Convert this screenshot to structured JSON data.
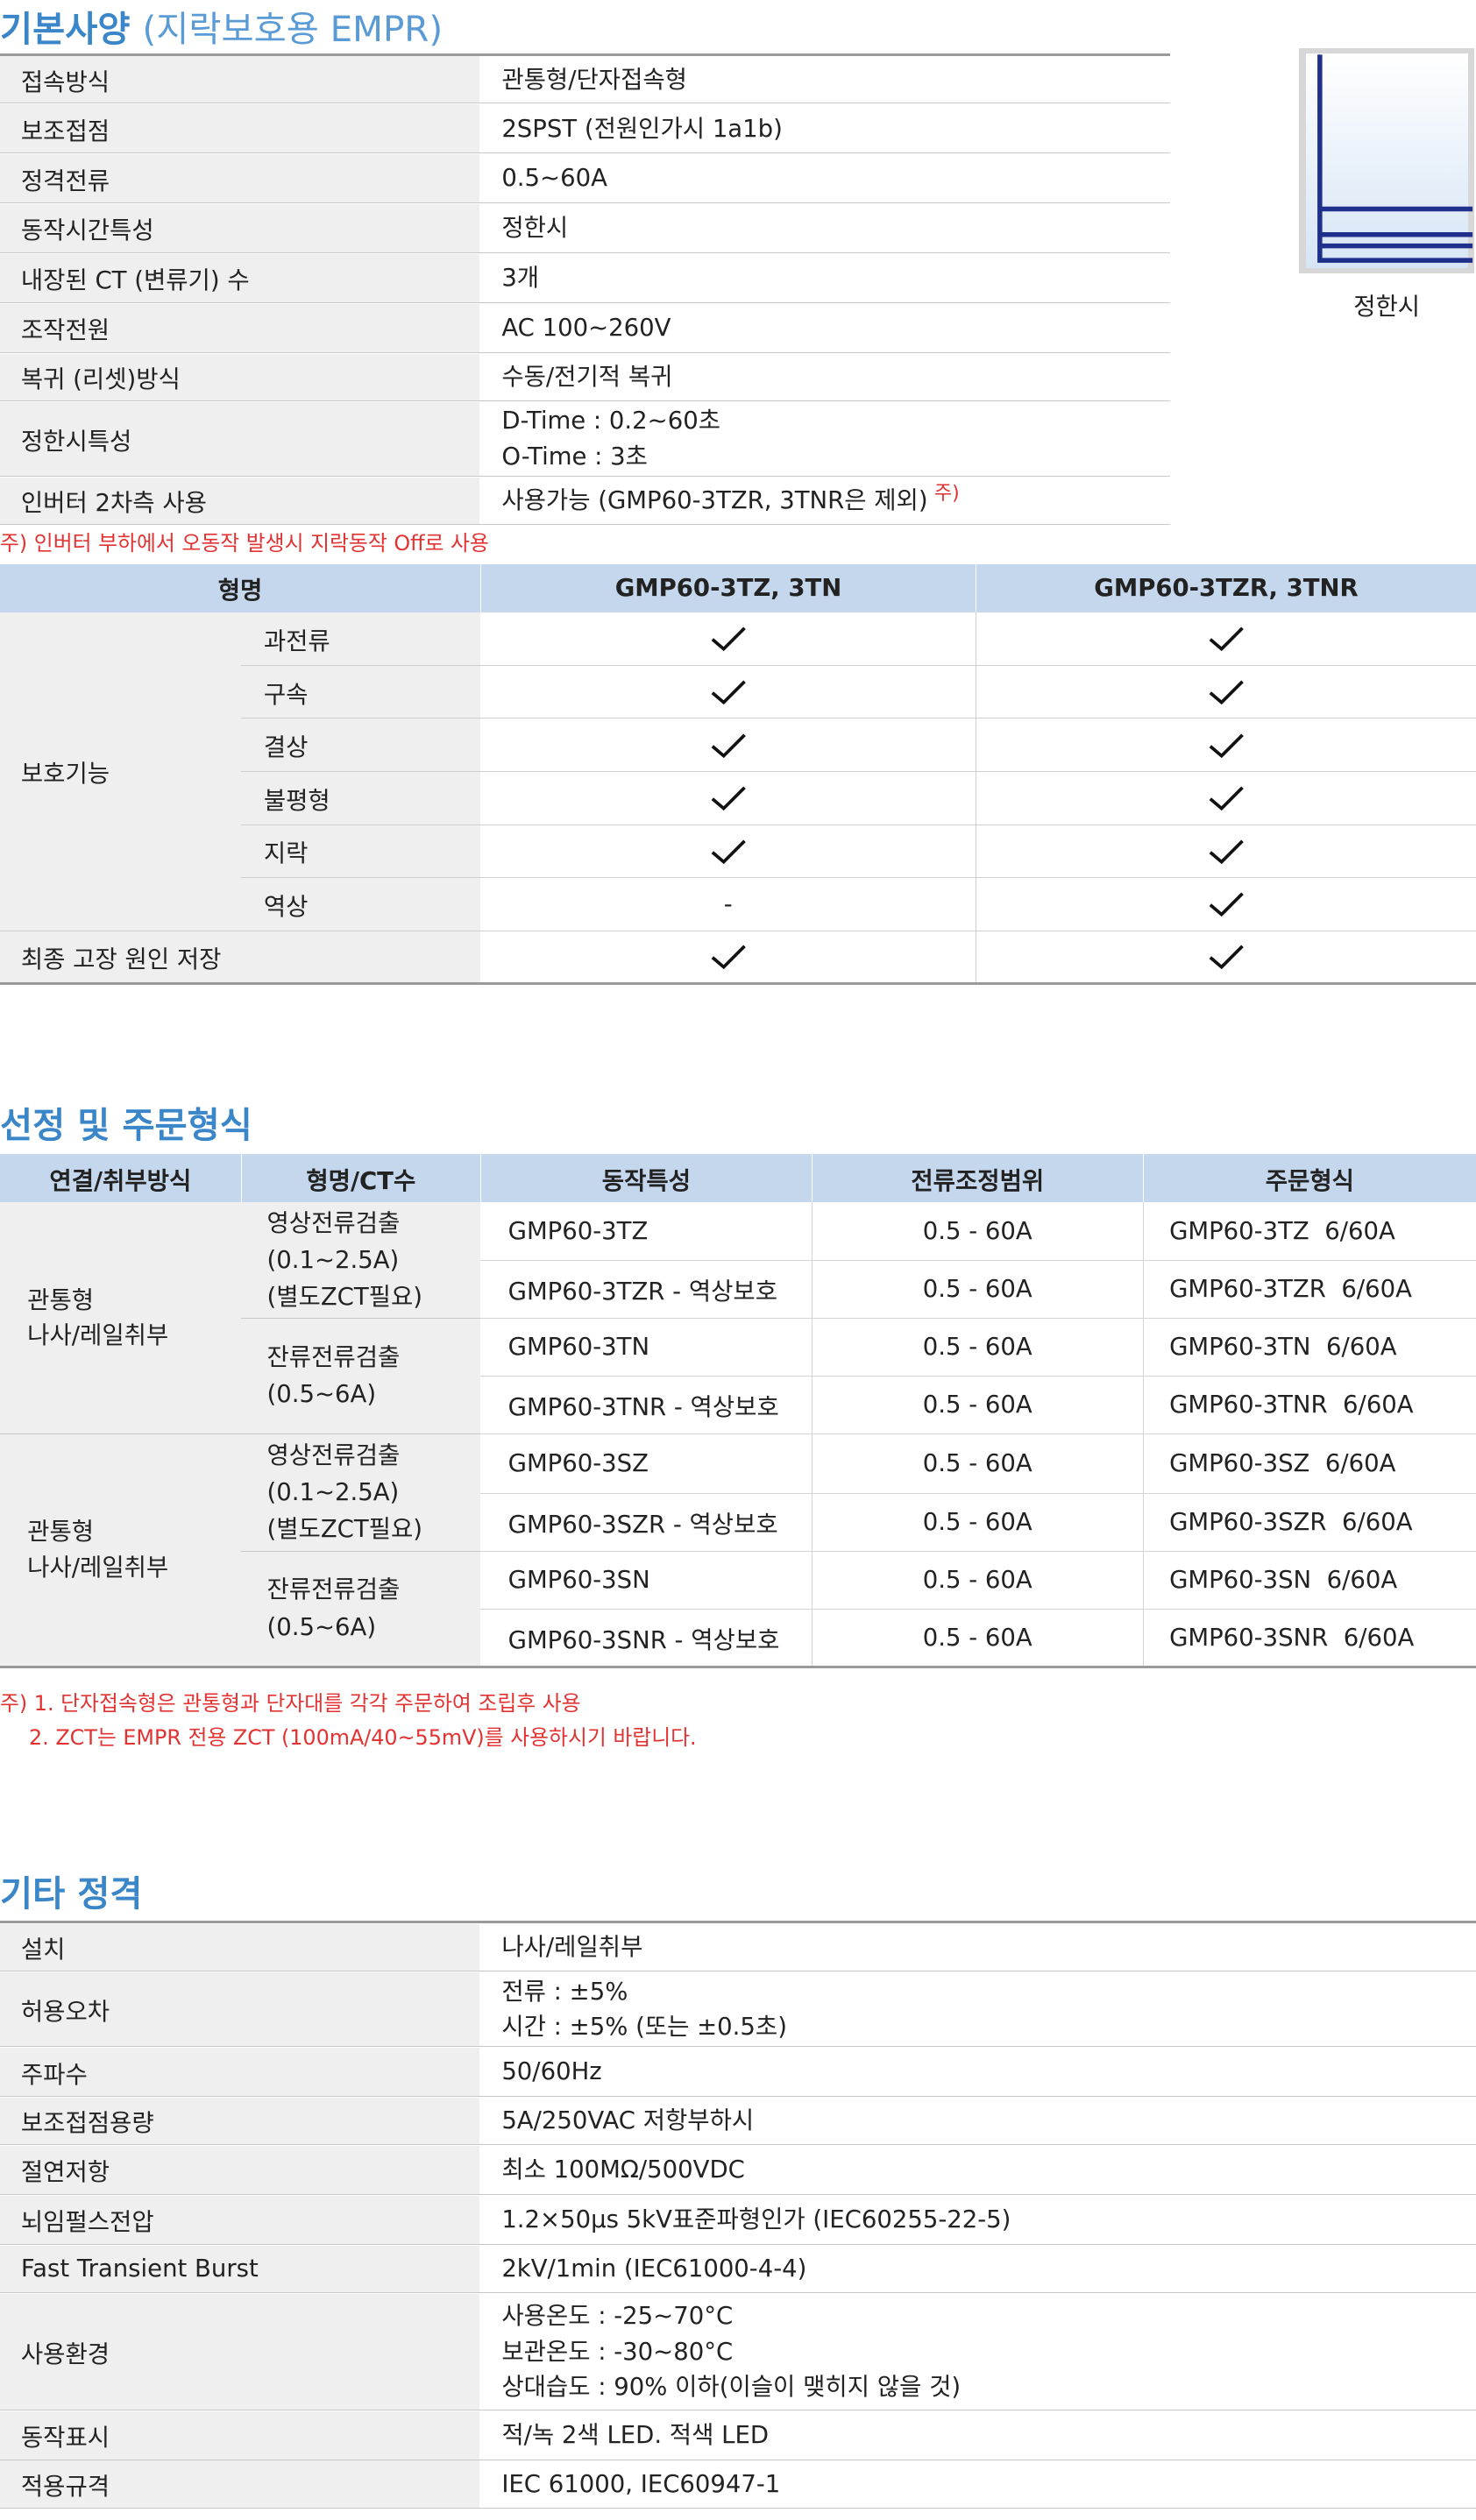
{
  "section1": {
    "title": "기본사양",
    "subtitle": "(지락보호용 EMPR)",
    "specs": [
      {
        "label": "접속방식",
        "value": "관통형/단자접속형"
      },
      {
        "label": "보조접점",
        "value": "2SPST (전원인가시 1a1b)"
      },
      {
        "label": "정격전류",
        "value": "0.5~60A"
      },
      {
        "label": "동작시간특성",
        "value": "정한시"
      },
      {
        "label": "내장된 CT (변류기) 수",
        "value": "3개"
      },
      {
        "label": "조작전원",
        "value": "AC 100~260V"
      },
      {
        "label": "복귀 (리셋)방식",
        "value": "수동/전기적 복귀"
      },
      {
        "label": "정한시특성",
        "value": "D-Time : 0.2~60초",
        "value2": "O-Time : 3초"
      },
      {
        "label": "인버터 2차측 사용",
        "value": "사용가능 (GMP60-3TZR, 3TNR은 제외)",
        "mark": "주)"
      }
    ],
    "note": "주) 인버터 부하에서 오동작 발생시 지락동작 Off로 사용",
    "figure_caption": "정한시"
  },
  "protection": {
    "header_model": "형명",
    "col1": "GMP60-3TZ, 3TN",
    "col2": "GMP60-3TZR, 3TNR",
    "group": "보호기능",
    "rows": [
      {
        "label": "과전류",
        "c1": true,
        "c2": true
      },
      {
        "label": "구속",
        "c1": true,
        "c2": true
      },
      {
        "label": "결상",
        "c1": true,
        "c2": true
      },
      {
        "label": "불평형",
        "c1": true,
        "c2": true
      },
      {
        "label": "지락",
        "c1": true,
        "c2": true
      },
      {
        "label": "역상",
        "c1": false,
        "c2": true
      }
    ],
    "dash": "-",
    "last": {
      "label": "최종 고장 원인 저장",
      "c1": true,
      "c2": true
    }
  },
  "section2": {
    "title": "선정 및 주문형식",
    "headers": [
      "연결/취부방식",
      "형명/CT수",
      "동작특성",
      "전류조정범위",
      "주문형식"
    ],
    "groups": [
      {
        "conn1": "관통형",
        "conn2": "나사/레일취부",
        "sub": [
          {
            "l1": "영상전류검출",
            "l2": "(0.1~2.5A)",
            "l3": "(별도ZCT필요)",
            "rows": [
              {
                "op": "GMP60-3TZ",
                "range": "0.5 - 60A",
                "order": "GMP60-3TZ  6/60A"
              },
              {
                "op": "GMP60-3TZR - 역상보호",
                "range": "0.5 - 60A",
                "order": "GMP60-3TZR  6/60A"
              }
            ]
          },
          {
            "l1": "잔류전류검출",
            "l2": "(0.5~6A)",
            "rows": [
              {
                "op": "GMP60-3TN",
                "range": "0.5 - 60A",
                "order": "GMP60-3TN  6/60A"
              },
              {
                "op": "GMP60-3TNR - 역상보호",
                "range": "0.5 - 60A",
                "order": "GMP60-3TNR  6/60A"
              }
            ]
          }
        ]
      },
      {
        "conn1": "관통형",
        "conn2": "나사/레일취부",
        "sub": [
          {
            "l1": "영상전류검출",
            "l2": "(0.1~2.5A)",
            "l3": "(별도ZCT필요)",
            "rows": [
              {
                "op": "GMP60-3SZ",
                "range": "0.5 - 60A",
                "order": "GMP60-3SZ  6/60A"
              },
              {
                "op": "GMP60-3SZR - 역상보호",
                "range": "0.5 - 60A",
                "order": "GMP60-3SZR  6/60A"
              }
            ]
          },
          {
            "l1": "잔류전류검출",
            "l2": "(0.5~6A)",
            "rows": [
              {
                "op": "GMP60-3SN",
                "range": "0.5 - 60A",
                "order": "GMP60-3SN  6/60A"
              },
              {
                "op": "GMP60-3SNR - 역상보호",
                "range": "0.5 - 60A",
                "order": "GMP60-3SNR  6/60A"
              }
            ]
          }
        ]
      }
    ],
    "note1": "주) 1. 단자접속형은 관통형과 단자대를 각각 주문하여 조립후 사용",
    "note2": "2. ZCT는 EMPR 전용 ZCT (100mA/40~55mV)를 사용하시기 바랍니다."
  },
  "section3": {
    "title": "기타 정격",
    "specs": [
      {
        "label": "설치",
        "lines": [
          "나사/레일취부"
        ]
      },
      {
        "label": "허용오차",
        "lines": [
          "전류 : ±5%",
          "시간 : ±5% (또는 ±0.5초)"
        ]
      },
      {
        "label": "주파수",
        "lines": [
          "50/60Hz"
        ]
      },
      {
        "label": "보조접점용량",
        "lines": [
          "5A/250VAC 저항부하시"
        ]
      },
      {
        "label": "절연저항",
        "lines": [
          "최소 100MΩ/500VDC"
        ]
      },
      {
        "label": "뇌임펄스전압",
        "lines": [
          "1.2×50μs 5kV표준파형인가 (IEC60255-22-5)"
        ]
      },
      {
        "label": "Fast Transient Burst",
        "lines": [
          "2kV/1min (IEC61000-4-4)"
        ]
      },
      {
        "label": "사용환경",
        "lines": [
          "사용온도 : -25~70°C",
          "보관온도 : -30~80°C",
          "상대습도 : 90% 이하(이슬이 맺히지 않을 것)"
        ]
      },
      {
        "label": "동작표시",
        "lines": [
          "적/녹 2색 LED. 적색 LED"
        ]
      },
      {
        "label": "적용규격",
        "lines": [
          "IEC 61000, IEC60947-1"
        ]
      }
    ]
  },
  "colors": {
    "accent": "#3a86c8",
    "header_bg": "#c5d7ed",
    "label_bg": "#efefef",
    "note": "#e23232"
  }
}
